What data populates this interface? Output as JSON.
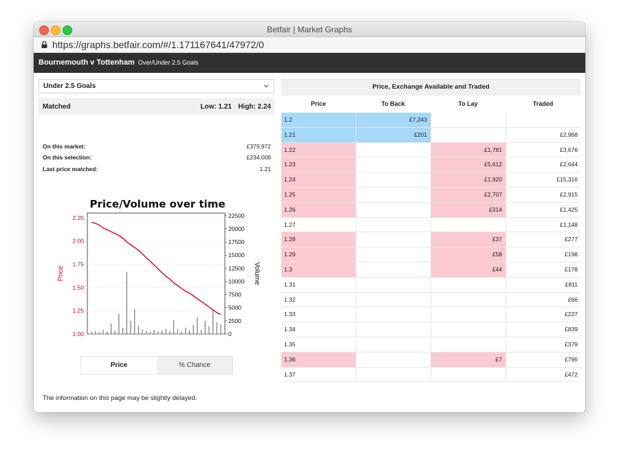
{
  "window": {
    "title": "Betfair | Market Graphs",
    "url": "https://graphs.betfair.com/#/1.171167641/47972/0"
  },
  "header": {
    "match": "Bournemouth v Tottenham",
    "market": "Over/Under 2.5 Goals"
  },
  "selection": {
    "value": "Under 2.5 Goals"
  },
  "matched": {
    "label": "Matched",
    "low": "Low: 1.21",
    "high": "High: 2.24"
  },
  "stats": [
    {
      "label": "On this market:",
      "value": "£379,972"
    },
    {
      "label": "On this selection:",
      "value": "£234,008"
    },
    {
      "label": "Last price matched:",
      "value": "1.21"
    }
  ],
  "toggle": {
    "price": "Price",
    "chance": "% Chance"
  },
  "notice": "The information on this page may be slightly delayed.",
  "table": {
    "title": "Price, Exchange Available and Traded",
    "headers": [
      "Price",
      "To Back",
      "To Lay",
      "Traded"
    ],
    "rows": [
      {
        "price": "1.2",
        "back": "£7,243",
        "lay": "",
        "traded": "",
        "type": "back"
      },
      {
        "price": "1.21",
        "back": "£201",
        "lay": "",
        "traded": "£2,968",
        "type": "back"
      },
      {
        "price": "1.22",
        "back": "",
        "lay": "£1,781",
        "traded": "£3,676",
        "type": "lay"
      },
      {
        "price": "1.23",
        "back": "",
        "lay": "£5,612",
        "traded": "£2,644",
        "type": "lay"
      },
      {
        "price": "1.24",
        "back": "",
        "lay": "£1,920",
        "traded": "£15,316",
        "type": "lay"
      },
      {
        "price": "1.25",
        "back": "",
        "lay": "£2,707",
        "traded": "£2,915",
        "type": "lay"
      },
      {
        "price": "1.26",
        "back": "",
        "lay": "£314",
        "traded": "£1,425",
        "type": "lay"
      },
      {
        "price": "1.27",
        "back": "",
        "lay": "",
        "traded": "£1,148",
        "type": "none"
      },
      {
        "price": "1.28",
        "back": "",
        "lay": "£37",
        "traded": "£277",
        "type": "lay"
      },
      {
        "price": "1.29",
        "back": "",
        "lay": "£58",
        "traded": "£198",
        "type": "lay"
      },
      {
        "price": "1.3",
        "back": "",
        "lay": "£44",
        "traded": "£178",
        "type": "lay"
      },
      {
        "price": "1.31",
        "back": "",
        "lay": "",
        "traded": "£811",
        "type": "none"
      },
      {
        "price": "1.32",
        "back": "",
        "lay": "",
        "traded": "£66",
        "type": "none"
      },
      {
        "price": "1.33",
        "back": "",
        "lay": "",
        "traded": "£227",
        "type": "none"
      },
      {
        "price": "1.34",
        "back": "",
        "lay": "",
        "traded": "£839",
        "type": "none"
      },
      {
        "price": "1.35",
        "back": "",
        "lay": "",
        "traded": "£379",
        "type": "none"
      },
      {
        "price": "1.36",
        "back": "",
        "lay": "£7",
        "traded": "£796",
        "type": "lay"
      },
      {
        "price": "1.37",
        "back": "",
        "lay": "",
        "traded": "£472",
        "type": "none"
      }
    ]
  },
  "colors": {
    "back": "#a6d8f7",
    "lay": "#fac9d1",
    "price_line": "#d0021b",
    "volume": "#777777",
    "header_bar": "#303030"
  },
  "chart_data": {
    "type": "line",
    "title": "Price/Volume over time",
    "ylabel": "Price",
    "y2label": "Volume",
    "ylim": [
      1.0,
      2.3
    ],
    "y2lim": [
      0,
      23000
    ],
    "yticks": [
      "1.00",
      "1.25",
      "1.50",
      "1.75",
      "2.00",
      "2.25"
    ],
    "y2ticks": [
      "0",
      "2500",
      "5000",
      "7500",
      "10000",
      "12500",
      "15000",
      "17500",
      "20000",
      "22500"
    ],
    "series": [
      {
        "values": [
          2.2,
          2.19,
          2.17,
          2.14,
          2.12,
          2.1,
          2.08,
          2.06,
          2.03,
          1.99,
          1.96,
          1.93,
          1.9,
          1.86,
          1.82,
          1.78,
          1.74,
          1.7,
          1.66,
          1.62,
          1.59,
          1.55,
          1.52,
          1.49,
          1.46,
          1.44,
          1.41,
          1.38,
          1.35,
          1.32,
          1.29,
          1.26,
          1.23,
          1.21
        ]
      },
      {
        "values": [
          400,
          600,
          300,
          800,
          500,
          2000,
          700,
          3800,
          1200,
          11800,
          2500,
          4700,
          1500,
          900,
          600,
          400,
          800,
          500,
          700,
          1000,
          600,
          2600,
          900,
          500,
          1200,
          700,
          1700,
          3200,
          800,
          2500,
          1500,
          4600,
          2200,
          1800
        ]
      }
    ]
  }
}
